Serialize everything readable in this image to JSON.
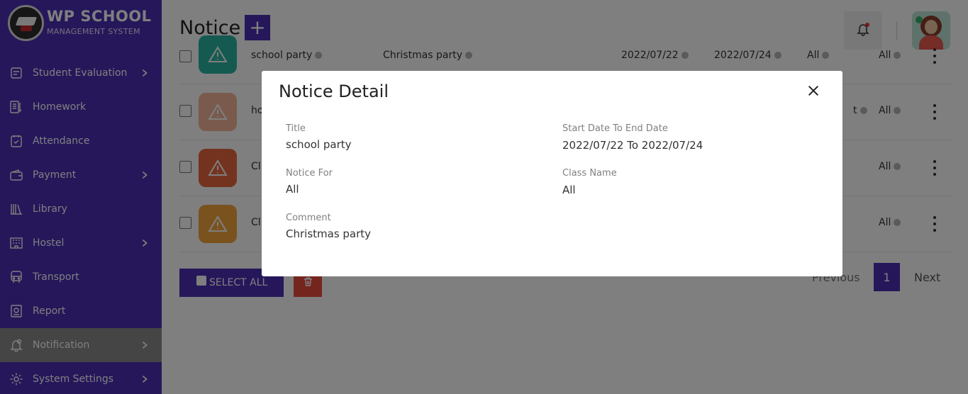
{
  "brand": {
    "title": "WP SCHOOL",
    "subtitle": "MANAGEMENT SYSTEM"
  },
  "sidebar": {
    "items": [
      {
        "label": "Student Evaluation",
        "icon": "evaluation-icon",
        "has_submenu": true
      },
      {
        "label": "Homework",
        "icon": "homework-icon",
        "has_submenu": false
      },
      {
        "label": "Attendance",
        "icon": "attendance-icon",
        "has_submenu": false
      },
      {
        "label": "Payment",
        "icon": "wallet-icon",
        "has_submenu": true
      },
      {
        "label": "Library",
        "icon": "library-icon",
        "has_submenu": false
      },
      {
        "label": "Hostel",
        "icon": "hostel-icon",
        "has_submenu": true
      },
      {
        "label": "Transport",
        "icon": "bus-icon",
        "has_submenu": false
      },
      {
        "label": "Report",
        "icon": "report-icon",
        "has_submenu": false
      },
      {
        "label": "Notification",
        "icon": "notification-bell-icon",
        "has_submenu": true,
        "active": true
      },
      {
        "label": "System Settings",
        "icon": "gear-icon",
        "has_submenu": true
      }
    ]
  },
  "header": {
    "page_title": "Notice",
    "add_label": "+"
  },
  "table": {
    "rows": [
      {
        "title": "school party",
        "comment": "Christmas party",
        "start": "2022/07/22",
        "end": "2022/07/24",
        "notice_for": "All",
        "class": "All",
        "color": "#2bb5a3"
      },
      {
        "title": "ho",
        "comment": "",
        "start": "",
        "end": "",
        "notice_for": "t",
        "class": "All",
        "color": "#f2b49a"
      },
      {
        "title": "Cl",
        "comment": "",
        "start": "",
        "end": "",
        "notice_for": "",
        "class": "All",
        "color": "#e8663d"
      },
      {
        "title": "Cl",
        "comment": "",
        "start": "",
        "end": "",
        "notice_for": "",
        "class": "All",
        "color": "#f2a53a"
      }
    ]
  },
  "actions": {
    "select_all": "SELECT ALL"
  },
  "pagination": {
    "previous": "Previous",
    "current_page": "1",
    "next": "Next"
  },
  "modal": {
    "title": "Notice Detail",
    "fields": {
      "title_label": "Title",
      "title_value": "school party",
      "dates_label": "Start Date To End Date",
      "dates_value": "2022/07/22 To 2022/07/24",
      "notice_for_label": "Notice For",
      "notice_for_value": "All",
      "class_label": "Class Name",
      "class_value": "All",
      "comment_label": "Comment",
      "comment_value": "Christmas party"
    }
  },
  "colors": {
    "primary": "#4c2fb6",
    "danger": "#e84c3d",
    "overlay": "rgba(0,0,0,0.5)"
  }
}
